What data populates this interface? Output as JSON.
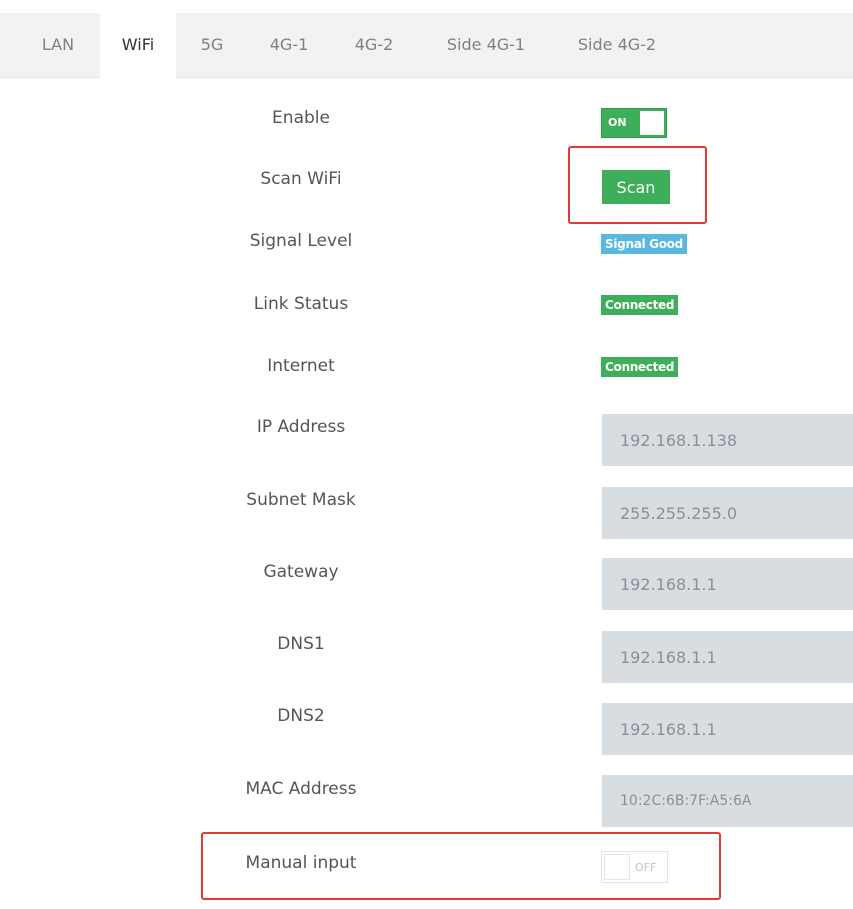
{
  "tabs": [
    {
      "label": "LAN",
      "active": false
    },
    {
      "label": "WiFi",
      "active": true
    },
    {
      "label": "5G",
      "active": false
    },
    {
      "label": "4G-1",
      "active": false
    },
    {
      "label": "4G-2",
      "active": false
    },
    {
      "label": "Side 4G-1",
      "active": false
    },
    {
      "label": "Side 4G-2",
      "active": false
    }
  ],
  "form": {
    "enable": {
      "label": "Enable",
      "state": "ON"
    },
    "scan": {
      "label": "Scan WiFi",
      "button": "Scan"
    },
    "signal": {
      "label": "Signal Level",
      "value": "Signal Good"
    },
    "link": {
      "label": "Link Status",
      "value": "Connected"
    },
    "internet": {
      "label": "Internet",
      "value": "Connected"
    },
    "ip": {
      "label": "IP Address",
      "value": "192.168.1.138"
    },
    "subnet": {
      "label": "Subnet Mask",
      "value": "255.255.255.0"
    },
    "gateway": {
      "label": "Gateway",
      "value": "192.168.1.1"
    },
    "dns1": {
      "label": "DNS1",
      "value": "192.168.1.1"
    },
    "dns2": {
      "label": "DNS2",
      "value": "192.168.1.1"
    },
    "mac": {
      "label": "MAC Address",
      "value": "10:2C:6B:7F:A5:6A"
    },
    "manual": {
      "label": "Manual input",
      "state": "OFF"
    }
  },
  "colors": {
    "accent_green": "#3fae5a",
    "badge_blue": "#59b7e0",
    "highlight_red": "#e53935",
    "field_bg": "#d7dde1",
    "tabbar_bg": "#f2f2f2"
  }
}
